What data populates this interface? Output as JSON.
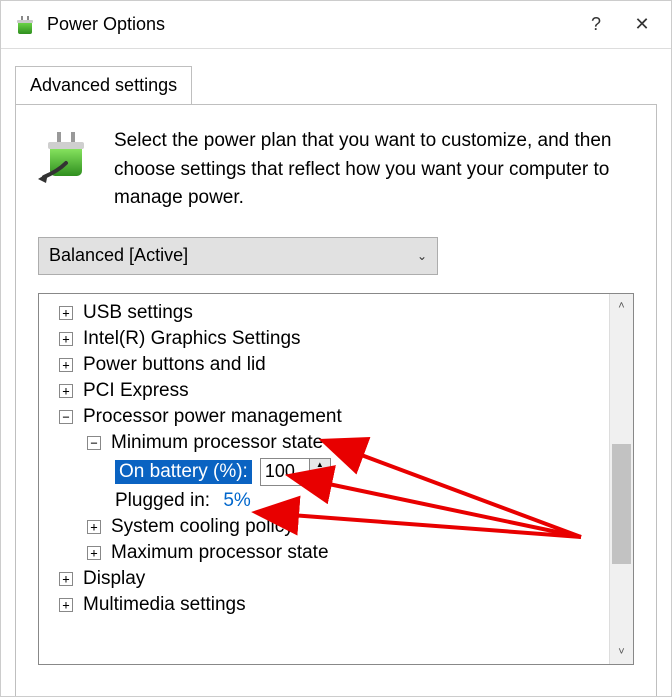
{
  "window": {
    "title": "Power Options",
    "help": "?",
    "close": "✕"
  },
  "tab": {
    "label": "Advanced settings"
  },
  "intro": {
    "text": "Select the power plan that you want to customize, and then choose settings that reflect how you want your computer to manage power."
  },
  "plan": {
    "selected": "Balanced [Active]"
  },
  "tree": {
    "usb": "USB settings",
    "intel": "Intel(R) Graphics Settings",
    "power_buttons": "Power buttons and lid",
    "pci": "PCI Express",
    "ppm": "Processor power management",
    "min_state": "Minimum processor state",
    "on_battery_label": "On battery (%):",
    "on_battery_value": "100",
    "plugged_in_label": "Plugged in:",
    "plugged_in_value": "5%",
    "cooling": "System cooling policy",
    "max_state": "Maximum processor state",
    "display": "Display",
    "multimedia": "Multimedia settings"
  },
  "glyphs": {
    "plus": "+",
    "minus": "−",
    "chevron_down": "⌄",
    "tri_up": "▲",
    "tri_down": "▼"
  }
}
